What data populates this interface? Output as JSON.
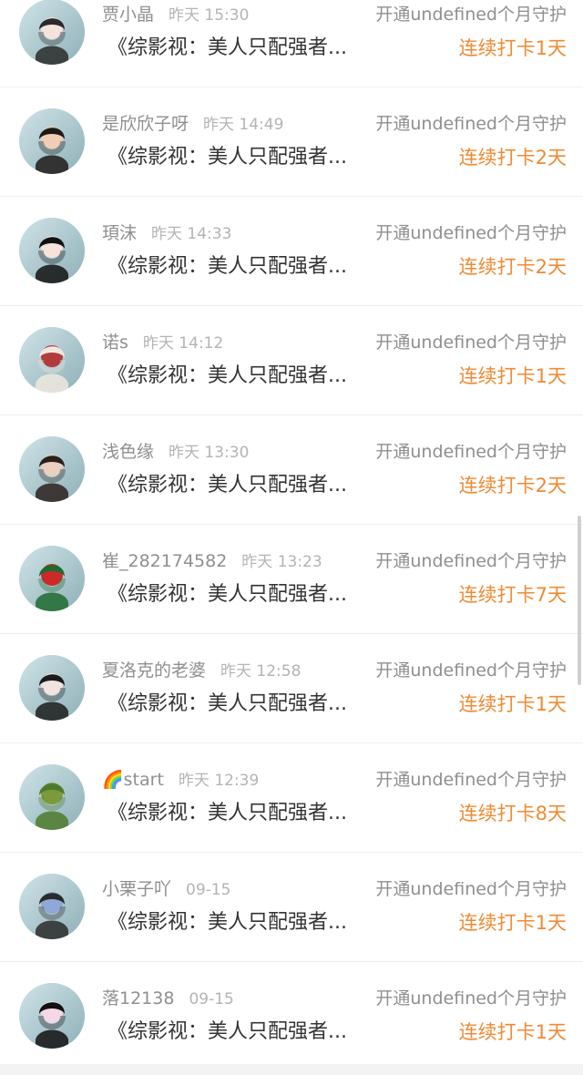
{
  "colors": {
    "accent": "#f08a33",
    "secondary_text": "#8f8f8f",
    "primary_text": "#333333"
  },
  "items": [
    {
      "name": "贾小晶",
      "time": "昨天 15:30",
      "title": "《综影视：美人只配强者...",
      "action": "开通undefined个月守护",
      "streak": "连续打卡1天",
      "avatar_palette": [
        "#cfe3e8",
        "#8fb0b8",
        "#2a2a2a",
        "#f4e2dc"
      ]
    },
    {
      "name": "是欣欣子呀",
      "time": "昨天 14:49",
      "title": "《综影视：美人只配强者...",
      "action": "开通undefined个月守护",
      "streak": "连续打卡2天",
      "avatar_palette": [
        "#e6b048",
        "#b06a26",
        "#1e1a18",
        "#f2cdb6"
      ]
    },
    {
      "name": "頊沫",
      "time": "昨天 14:33",
      "title": "《综影视：美人只配强者...",
      "action": "开通undefined个月守护",
      "streak": "连续打卡2天",
      "avatar_palette": [
        "#f5f5f5",
        "#e0e0e0",
        "#121212",
        "#f6e3da"
      ]
    },
    {
      "name": "诺s",
      "time": "昨天 14:12",
      "title": "《综影视：美人只配强者...",
      "action": "开通undefined个月守护",
      "streak": "连续打卡1天",
      "avatar_palette": [
        "#ffffff",
        "#f3f3f3",
        "#f0e7df",
        "#b23b3b"
      ]
    },
    {
      "name": "浅色缘",
      "time": "昨天 13:30",
      "title": "《综影视：美人只配强者...",
      "action": "开通undefined个月守护",
      "streak": "连续打卡2天",
      "avatar_palette": [
        "#f2f2f2",
        "#cfcfcf",
        "#2b211c",
        "#e9d0c0"
      ]
    },
    {
      "name": "崔_282174582",
      "time": "昨天 13:23",
      "title": "《综影视：美人只配强者...",
      "action": "开通undefined个月守护",
      "streak": "连续打卡7天",
      "avatar_palette": [
        "#f1f1f1",
        "#d9d9d9",
        "#1f6b2f",
        "#cc2a2a"
      ]
    },
    {
      "name": "夏洛克的老婆",
      "time": "昨天 12:58",
      "title": "《综影视：美人只配强者...",
      "action": "开通undefined个月守护",
      "streak": "连续打卡1天",
      "avatar_palette": [
        "#b82020",
        "#5a1414",
        "#1c1c1c",
        "#f2e2e0"
      ]
    },
    {
      "name": "🌈start",
      "time": "昨天 12:39",
      "title": "《综影视：美人只配强者...",
      "action": "开通undefined个月守护",
      "streak": "连续打卡8天",
      "avatar_palette": [
        "#6d86a6",
        "#9eb3c7",
        "#4d7a2c",
        "#7c9a3a"
      ]
    },
    {
      "name": "小栗子吖",
      "time": "09-15",
      "title": "《综影视：美人只配强者...",
      "action": "开通undefined个月守护",
      "streak": "连续打卡1天",
      "avatar_palette": [
        "#f4f4f4",
        "#e7e7e7",
        "#2a2a2a",
        "#8fa8d8"
      ]
    },
    {
      "name": "落12138",
      "time": "09-15",
      "title": "《综影视：美人只配强者...",
      "action": "开通undefined个月守护",
      "streak": "连续打卡1天",
      "avatar_palette": [
        "#f6f6f6",
        "#f3c7d6",
        "#111111",
        "#f6d7e5"
      ]
    }
  ]
}
